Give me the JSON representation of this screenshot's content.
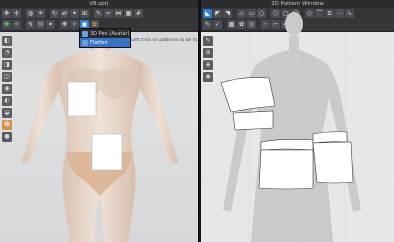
{
  "window3d": {
    "title": "V8.zprj"
  },
  "window2d": {
    "title": "2D Pattern Window"
  },
  "dropdown": {
    "items": [
      {
        "label": "3D Pen (Avatar)",
        "icon": "pen-icon",
        "selected": false
      },
      {
        "label": "Flatten",
        "icon": "flatten-icon",
        "selected": true
      }
    ]
  },
  "tooltip": {
    "text": "Left click on patterns to be flattened then..."
  },
  "colors": {
    "accent": "#3a73c4",
    "pattern_fill": "#ffffff",
    "body_silhouette": "#c9cacc"
  }
}
